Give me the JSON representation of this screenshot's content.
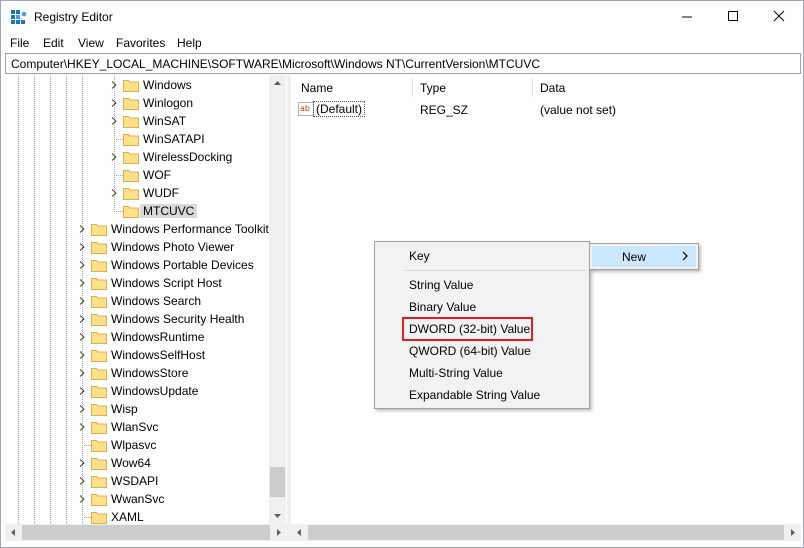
{
  "window": {
    "title": "Registry Editor",
    "colors": {
      "accent": "#0078d7",
      "highlight_box": "#e02020",
      "menu_hover": "#cce8ff",
      "folder": "#ffe08a"
    }
  },
  "menubar": {
    "items": [
      "File",
      "Edit",
      "View",
      "Favorites",
      "Help"
    ]
  },
  "address": {
    "path": "Computer\\HKEY_LOCAL_MACHINE\\SOFTWARE\\Microsoft\\Windows NT\\CurrentVersion\\MTCUVC"
  },
  "tree": {
    "items": [
      {
        "label": "Windows",
        "expandable": true
      },
      {
        "label": "Winlogon",
        "expandable": true
      },
      {
        "label": "WinSAT",
        "expandable": true
      },
      {
        "label": "WinSATAPI",
        "expandable": false
      },
      {
        "label": "WirelessDocking",
        "expandable": true
      },
      {
        "label": "WOF",
        "expandable": false
      },
      {
        "label": "WUDF",
        "expandable": true
      },
      {
        "label": "MTCUVC",
        "expandable": false,
        "selected": true
      },
      {
        "label": "Windows Performance Toolkit",
        "expandable": true
      },
      {
        "label": "Windows Photo Viewer",
        "expandable": true
      },
      {
        "label": "Windows Portable Devices",
        "expandable": true
      },
      {
        "label": "Windows Script Host",
        "expandable": true
      },
      {
        "label": "Windows Search",
        "expandable": true
      },
      {
        "label": "Windows Security Health",
        "expandable": true
      },
      {
        "label": "WindowsRuntime",
        "expandable": true
      },
      {
        "label": "WindowsSelfHost",
        "expandable": true
      },
      {
        "label": "WindowsStore",
        "expandable": true
      },
      {
        "label": "WindowsUpdate",
        "expandable": true
      },
      {
        "label": "Wisp",
        "expandable": true
      },
      {
        "label": "WlanSvc",
        "expandable": true
      },
      {
        "label": "Wlpasvc",
        "expandable": false
      },
      {
        "label": "Wow64",
        "expandable": true
      },
      {
        "label": "WSDAPI",
        "expandable": true
      },
      {
        "label": "WwanSvc",
        "expandable": true
      },
      {
        "label": "XAML",
        "expandable": false
      }
    ]
  },
  "list": {
    "columns": {
      "name": "Name",
      "type": "Type",
      "data": "Data"
    },
    "rows": [
      {
        "name": "(Default)",
        "type": "REG_SZ",
        "data": "(value not set)",
        "icon": "string-value-icon"
      }
    ]
  },
  "context_menu": {
    "items": [
      "Key",
      "String Value",
      "Binary Value",
      "DWORD (32-bit) Value",
      "QWORD (64-bit) Value",
      "Multi-String Value",
      "Expandable String Value"
    ],
    "highlighted": "DWORD (32-bit) Value"
  },
  "submenu_parent": {
    "label": "New"
  }
}
